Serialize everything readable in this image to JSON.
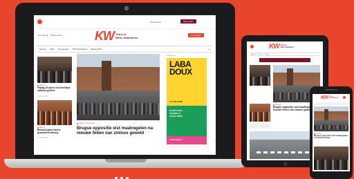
{
  "brand": {
    "logo_letters": "KW",
    "logo_lines": [
      "Thuis in",
      "West-Vlaanderen"
    ],
    "accent": "#e8452c",
    "dark_accent": "#7b1326"
  },
  "laptop": {
    "top_left_links": [
      "Zondag 24",
      "Regio kiezen"
    ],
    "top_right_links": [
      "Lid worden",
      "Inloggen"
    ],
    "newsletter_btn": "Nieuwsbrief",
    "account_btn": "Mijn profiel",
    "nav": [
      "Nieuws",
      "Sport",
      "Gemeentes",
      "VIP Restaurants",
      "Brieven/KW"
    ],
    "articles_left": [
      {
        "category": "Nieuws",
        "text": "Vrijdag 18 april in het Kortrijkse stadhuis gevierd",
        "meta": "12 april 2024"
      },
      {
        "category": "Nieuws",
        "text": "Brussels gaan nieuwe gezondheid inbreng",
        "meta": "12 april 2024"
      }
    ],
    "main_article": {
      "category": "Nieuws | Gemeenten",
      "headline": "Brugse oppositie eist maatregelen na nieuwe feiten van zinloos geweld"
    },
    "ad": {
      "label": "Advertentie",
      "title_line_1": "LABA",
      "title_line_2": "DOUX",
      "dates": "1-7 JULI 2024",
      "green_lines": [
        "GOOD FOOD",
        "FRIENDS &",
        "GOOD TIMES"
      ],
      "pink_text": "LABA DOUX"
    }
  },
  "tablet": {
    "tabs": [
      "Nieuws",
      "Sport",
      "Regio"
    ],
    "articles": [
      {
        "category": "Nieuws",
        "text": "Brugse oppositie eist maatregelen na nieuwe feiten van zinloos geweld"
      }
    ]
  },
  "phone": {
    "articles": [
      {
        "category": "Nieuws",
        "text": "Brugse oppositie eist maatregelen na nieuwe feiten"
      }
    ]
  }
}
